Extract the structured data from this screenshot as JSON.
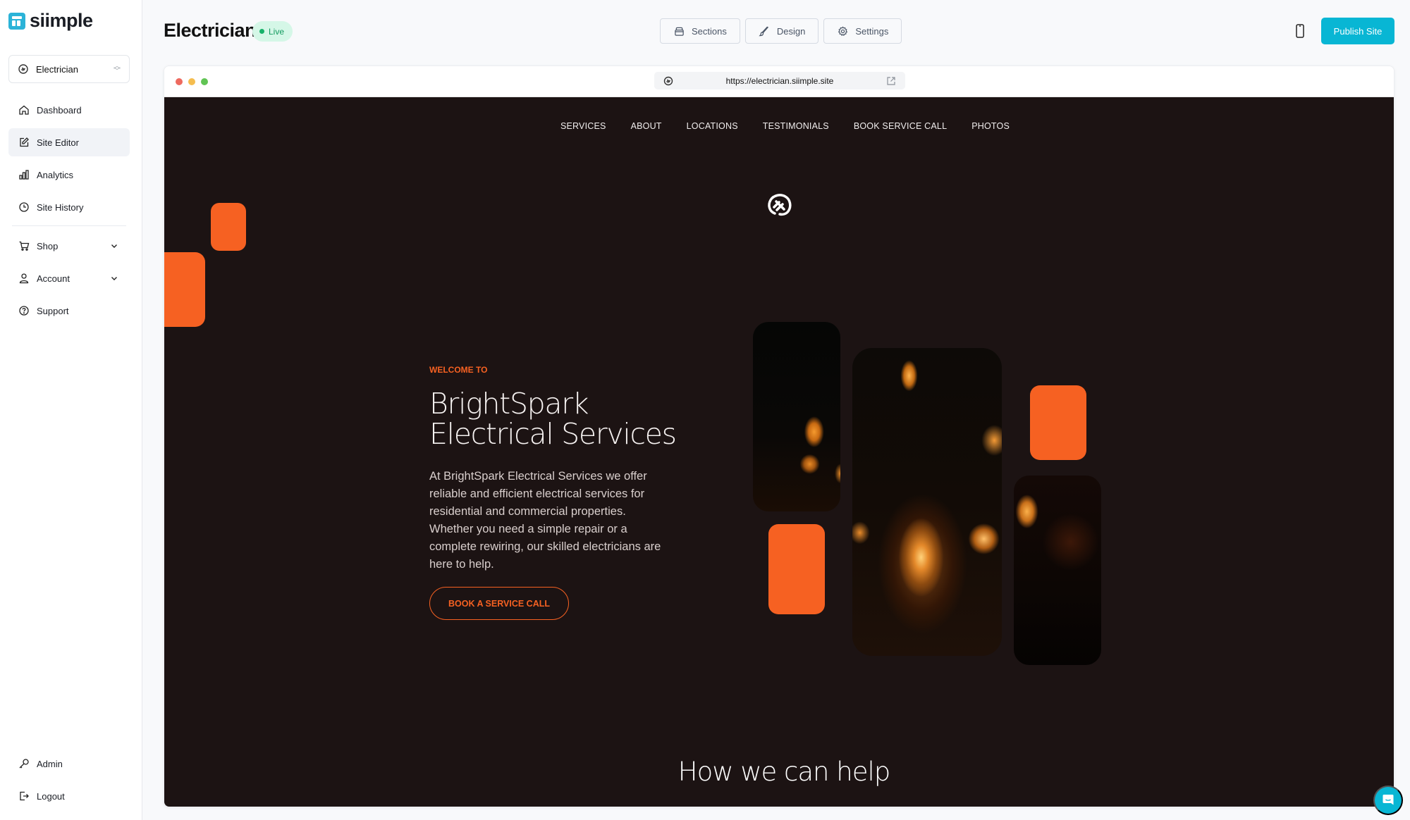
{
  "app": {
    "brand": "siimple",
    "site_selector": {
      "value": "Electrician"
    }
  },
  "sidebar": {
    "items": [
      {
        "label": "Dashboard",
        "icon": "home-icon"
      },
      {
        "label": "Site Editor",
        "icon": "edit-icon",
        "active": true
      },
      {
        "label": "Analytics",
        "icon": "bar-chart-icon"
      },
      {
        "label": "Site History",
        "icon": "clock-icon"
      },
      {
        "label": "Shop",
        "icon": "cart-icon",
        "expandable": true
      },
      {
        "label": "Account",
        "icon": "user-icon",
        "expandable": true
      },
      {
        "label": "Support",
        "icon": "help-circle-icon"
      }
    ],
    "bottom_items": [
      {
        "label": "Admin",
        "icon": "key-icon"
      },
      {
        "label": "Logout",
        "icon": "logout-icon"
      }
    ]
  },
  "header": {
    "title": "Electrician",
    "status_badge": "Live",
    "tabs": [
      {
        "label": "Sections",
        "icon": "layers-icon"
      },
      {
        "label": "Design",
        "icon": "brush-icon"
      },
      {
        "label": "Settings",
        "icon": "gear-icon"
      }
    ],
    "device_toggle_icon": "mobile-icon",
    "publish_label": "Publish Site"
  },
  "browser": {
    "url": "https://electrician.siimple.site",
    "traffic_light_colors": [
      "#ee6a5f",
      "#f5bd4f",
      "#61c454"
    ]
  },
  "website": {
    "nav": [
      "SERVICES",
      "ABOUT",
      "LOCATIONS",
      "TESTIMONIALS",
      "BOOK SERVICE CALL",
      "PHOTOS"
    ],
    "hero": {
      "eyebrow": "WELCOME TO",
      "title_line1": "BrightSpark",
      "title_line2": "Electrical Services",
      "description": "At BrightSpark Electrical Services we offer reliable and efficient electrical services for residential and commercial properties. Whether you need a simple repair or a complete rewiring, our skilled electricians are here to help.",
      "cta_label": "BOOK A SERVICE CALL"
    },
    "next_section_title": "How we can help",
    "colors": {
      "background": "#1c1313",
      "accent": "#f66122",
      "text": "#f6f2f1"
    }
  },
  "colors": {
    "primary": "#08b6d4",
    "live_badge_bg": "#d5f7e7",
    "live_badge_text": "#139b5f"
  }
}
